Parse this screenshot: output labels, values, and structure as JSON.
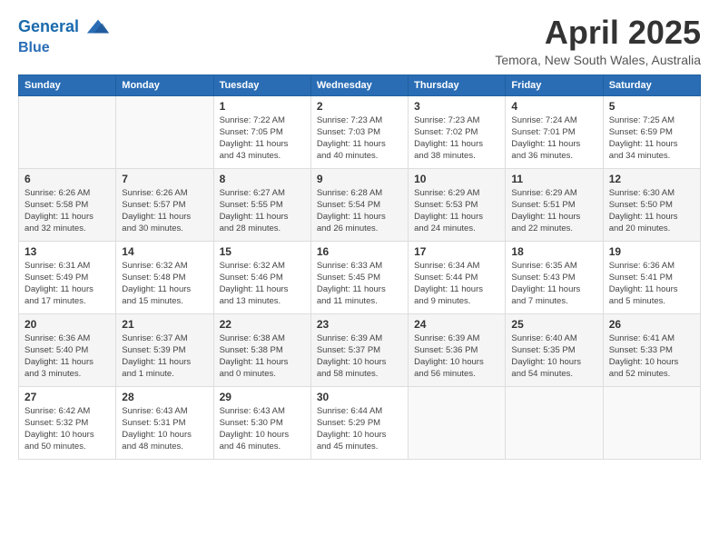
{
  "header": {
    "logo_line1": "General",
    "logo_line2": "Blue",
    "month": "April 2025",
    "location": "Temora, New South Wales, Australia"
  },
  "weekdays": [
    "Sunday",
    "Monday",
    "Tuesday",
    "Wednesday",
    "Thursday",
    "Friday",
    "Saturday"
  ],
  "weeks": [
    [
      {
        "day": "",
        "detail": ""
      },
      {
        "day": "",
        "detail": ""
      },
      {
        "day": "1",
        "detail": "Sunrise: 7:22 AM\nSunset: 7:05 PM\nDaylight: 11 hours and 43 minutes."
      },
      {
        "day": "2",
        "detail": "Sunrise: 7:23 AM\nSunset: 7:03 PM\nDaylight: 11 hours and 40 minutes."
      },
      {
        "day": "3",
        "detail": "Sunrise: 7:23 AM\nSunset: 7:02 PM\nDaylight: 11 hours and 38 minutes."
      },
      {
        "day": "4",
        "detail": "Sunrise: 7:24 AM\nSunset: 7:01 PM\nDaylight: 11 hours and 36 minutes."
      },
      {
        "day": "5",
        "detail": "Sunrise: 7:25 AM\nSunset: 6:59 PM\nDaylight: 11 hours and 34 minutes."
      }
    ],
    [
      {
        "day": "6",
        "detail": "Sunrise: 6:26 AM\nSunset: 5:58 PM\nDaylight: 11 hours and 32 minutes."
      },
      {
        "day": "7",
        "detail": "Sunrise: 6:26 AM\nSunset: 5:57 PM\nDaylight: 11 hours and 30 minutes."
      },
      {
        "day": "8",
        "detail": "Sunrise: 6:27 AM\nSunset: 5:55 PM\nDaylight: 11 hours and 28 minutes."
      },
      {
        "day": "9",
        "detail": "Sunrise: 6:28 AM\nSunset: 5:54 PM\nDaylight: 11 hours and 26 minutes."
      },
      {
        "day": "10",
        "detail": "Sunrise: 6:29 AM\nSunset: 5:53 PM\nDaylight: 11 hours and 24 minutes."
      },
      {
        "day": "11",
        "detail": "Sunrise: 6:29 AM\nSunset: 5:51 PM\nDaylight: 11 hours and 22 minutes."
      },
      {
        "day": "12",
        "detail": "Sunrise: 6:30 AM\nSunset: 5:50 PM\nDaylight: 11 hours and 20 minutes."
      }
    ],
    [
      {
        "day": "13",
        "detail": "Sunrise: 6:31 AM\nSunset: 5:49 PM\nDaylight: 11 hours and 17 minutes."
      },
      {
        "day": "14",
        "detail": "Sunrise: 6:32 AM\nSunset: 5:48 PM\nDaylight: 11 hours and 15 minutes."
      },
      {
        "day": "15",
        "detail": "Sunrise: 6:32 AM\nSunset: 5:46 PM\nDaylight: 11 hours and 13 minutes."
      },
      {
        "day": "16",
        "detail": "Sunrise: 6:33 AM\nSunset: 5:45 PM\nDaylight: 11 hours and 11 minutes."
      },
      {
        "day": "17",
        "detail": "Sunrise: 6:34 AM\nSunset: 5:44 PM\nDaylight: 11 hours and 9 minutes."
      },
      {
        "day": "18",
        "detail": "Sunrise: 6:35 AM\nSunset: 5:43 PM\nDaylight: 11 hours and 7 minutes."
      },
      {
        "day": "19",
        "detail": "Sunrise: 6:36 AM\nSunset: 5:41 PM\nDaylight: 11 hours and 5 minutes."
      }
    ],
    [
      {
        "day": "20",
        "detail": "Sunrise: 6:36 AM\nSunset: 5:40 PM\nDaylight: 11 hours and 3 minutes."
      },
      {
        "day": "21",
        "detail": "Sunrise: 6:37 AM\nSunset: 5:39 PM\nDaylight: 11 hours and 1 minute."
      },
      {
        "day": "22",
        "detail": "Sunrise: 6:38 AM\nSunset: 5:38 PM\nDaylight: 11 hours and 0 minutes."
      },
      {
        "day": "23",
        "detail": "Sunrise: 6:39 AM\nSunset: 5:37 PM\nDaylight: 10 hours and 58 minutes."
      },
      {
        "day": "24",
        "detail": "Sunrise: 6:39 AM\nSunset: 5:36 PM\nDaylight: 10 hours and 56 minutes."
      },
      {
        "day": "25",
        "detail": "Sunrise: 6:40 AM\nSunset: 5:35 PM\nDaylight: 10 hours and 54 minutes."
      },
      {
        "day": "26",
        "detail": "Sunrise: 6:41 AM\nSunset: 5:33 PM\nDaylight: 10 hours and 52 minutes."
      }
    ],
    [
      {
        "day": "27",
        "detail": "Sunrise: 6:42 AM\nSunset: 5:32 PM\nDaylight: 10 hours and 50 minutes."
      },
      {
        "day": "28",
        "detail": "Sunrise: 6:43 AM\nSunset: 5:31 PM\nDaylight: 10 hours and 48 minutes."
      },
      {
        "day": "29",
        "detail": "Sunrise: 6:43 AM\nSunset: 5:30 PM\nDaylight: 10 hours and 46 minutes."
      },
      {
        "day": "30",
        "detail": "Sunrise: 6:44 AM\nSunset: 5:29 PM\nDaylight: 10 hours and 45 minutes."
      },
      {
        "day": "",
        "detail": ""
      },
      {
        "day": "",
        "detail": ""
      },
      {
        "day": "",
        "detail": ""
      }
    ]
  ]
}
